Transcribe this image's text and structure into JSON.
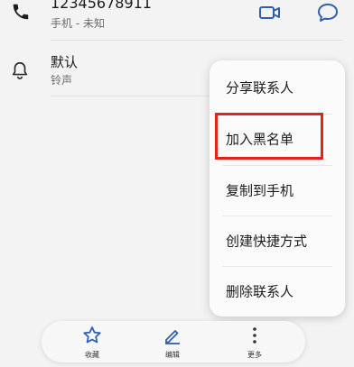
{
  "contact": {
    "phone_number": "12345678911",
    "phone_type": "手机 - 未知"
  },
  "ringtone": {
    "title": "默认",
    "subtitle": "铃声"
  },
  "menu": {
    "items": [
      {
        "label": "分享联系人"
      },
      {
        "label": "加入黑名单"
      },
      {
        "label": "复制到手机"
      },
      {
        "label": "创建快捷方式"
      },
      {
        "label": "删除联系人"
      }
    ],
    "highlighted_index": 1,
    "highlight_color": "#e3211d"
  },
  "bottom_bar": {
    "favorite_label": "收藏",
    "edit_label": "编辑",
    "more_label": "更多"
  },
  "colors": {
    "accent": "#2f5fb3"
  }
}
